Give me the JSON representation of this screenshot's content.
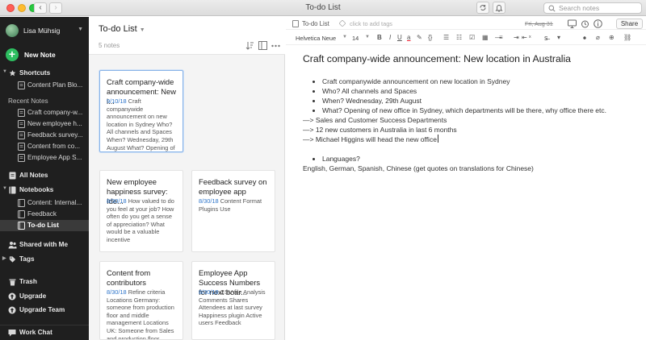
{
  "window": {
    "title": "To-do List"
  },
  "search": {
    "placeholder": "Search notes"
  },
  "sidebar": {
    "user_name": "Lisa Mühsig",
    "new_note_label": "New Note",
    "shortcuts_label": "Shortcuts",
    "shortcuts_items": [
      "Content Plan Blo..."
    ],
    "recent_label": "Recent Notes",
    "recent_items": [
      "Craft company-w...",
      "New employee h...",
      "Feedback survey...",
      "Content from co...",
      "Employee App S..."
    ],
    "all_notes_label": "All Notes",
    "notebooks_label": "Notebooks",
    "notebooks_items": [
      "Content: Internal...",
      "Feedback",
      "To-do List"
    ],
    "shared_label": "Shared with Me",
    "tags_label": "Tags",
    "trash_label": "Trash",
    "upgrade_label": "Upgrade",
    "upgrade_team_label": "Upgrade Team",
    "work_chat_label": "Work Chat"
  },
  "note_list": {
    "title": "To-do List",
    "count_label": "5 notes",
    "cards": [
      {
        "title": "Craft company-wide announcement: New l...",
        "date": "9/10/18",
        "snippet": "Craft companywide announcement on new location in Sydney Who? All channels and Spaces When? Wednesday, 29th August What? Opening of new office in Sydney, which departmen..."
      },
      {
        "title": "New employee happiness survey: Ide...",
        "date": "8/30/18",
        "snippet": "How valued to do you feel at your job? How often do you get a sense of appreciation? What would be a valuable incentive"
      },
      {
        "title": "Feedback survey on employee app",
        "date": "8/30/18",
        "snippet": "Content Format Plugins Use"
      },
      {
        "title": "Content from contributors",
        "date": "8/30/18",
        "snippet": "Refine criteria Locations Germany: someone from production floor and middle management Locations UK: Someone from Sales and production floor Locations B..."
      },
      {
        "title": "Employee App Success Numbers for next boar...",
        "date": "8/30/18",
        "snippet": "CSV-file Analysis Comments Shares Attendees at last survey Happiness plugin Active users Feedback"
      }
    ]
  },
  "editor": {
    "notebook_name": "To-do List",
    "tags_placeholder": "click to add tags",
    "date_label": "Fri, Aug 31",
    "share_label": "Share",
    "font_name": "Helvetica Neue",
    "font_size": "14",
    "note_title": "Craft company-wide announcement: New location in Australia",
    "bullets_a": [
      "Craft companywide announcement on new location in Sydney",
      "Who? All channels and Spaces",
      "When? Wednesday, 29th August",
      "What? Opening of new office in Sydney, which departments will be there, why office there etc."
    ],
    "lines": [
      "—> Sales and Customer Success Departments",
      "—>  12 new customers in Australia in last 6 months",
      "—> Michael Higgins will head the new office"
    ],
    "bullets_b": [
      "Languages?"
    ],
    "languages_line": "English, German, Spanish, Chinese (get quotes on translations for Chinese)"
  },
  "colors": {
    "accent_green": "#2dbe60",
    "sidebar_bg": "#1f1f1f",
    "link_blue": "#2b73c9"
  }
}
